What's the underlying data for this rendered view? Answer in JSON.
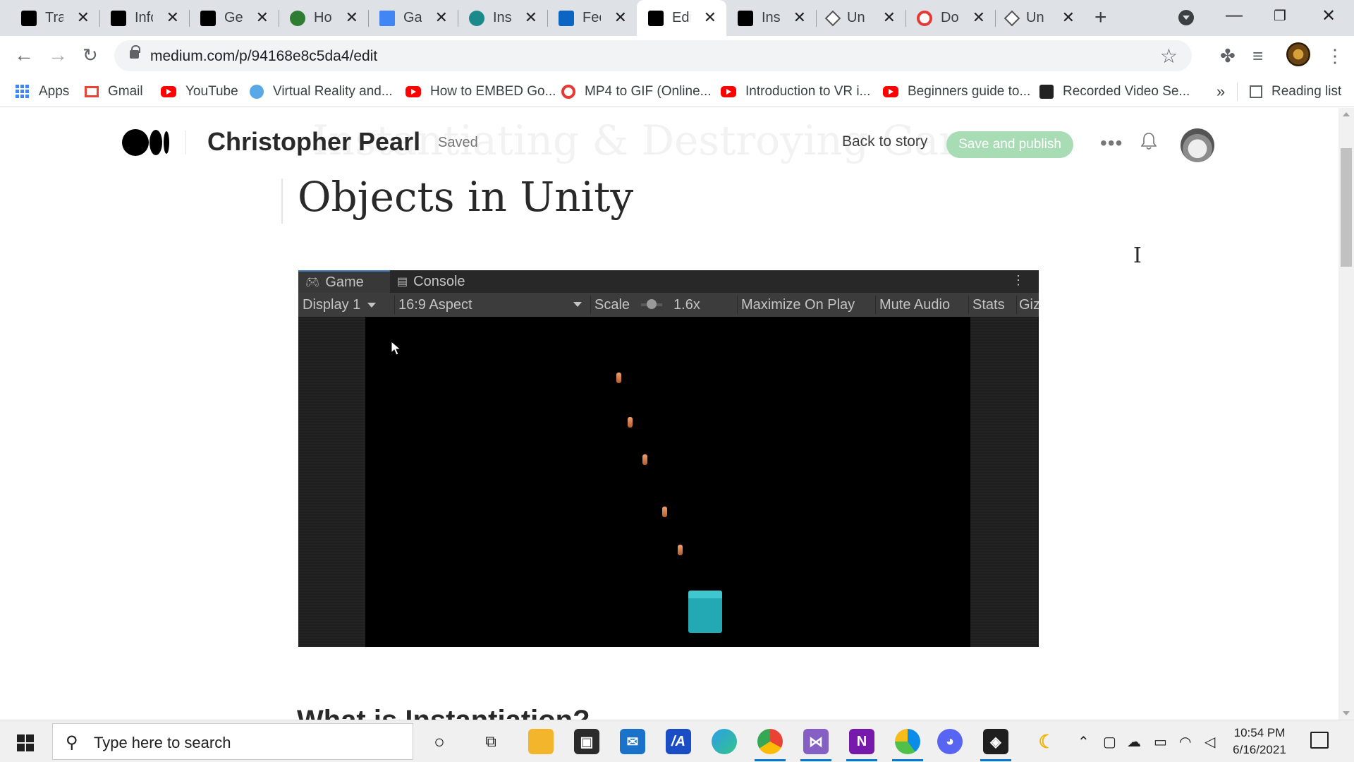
{
  "browser": {
    "tabs": [
      {
        "title": "Tran",
        "icon": "medium-icon",
        "active": false
      },
      {
        "title": "Info",
        "icon": "oculus-icon",
        "active": false
      },
      {
        "title": "Gen",
        "icon": "oculus-icon",
        "active": false
      },
      {
        "title": "How",
        "icon": "vr-icon",
        "active": false
      },
      {
        "title": "Gan",
        "icon": "google-docs-icon",
        "active": false
      },
      {
        "title": "Inst",
        "icon": "globe-icon",
        "active": false
      },
      {
        "title": "Fee",
        "icon": "linkedin-icon",
        "active": false
      },
      {
        "title": "Edit",
        "icon": "medium-icon",
        "active": true
      },
      {
        "title": "Inst",
        "icon": "medium-icon",
        "active": false
      },
      {
        "title": "Unit",
        "icon": "unity-icon",
        "active": false
      },
      {
        "title": "Dov",
        "icon": "mp4-gif-icon",
        "active": false
      },
      {
        "title": "Unit",
        "icon": "unity-icon",
        "active": false
      }
    ],
    "new_tab": "+",
    "url": "medium.com/p/94168e8c5da4/edit",
    "bookmarks": [
      {
        "label": "Apps",
        "icon": "apps-grid-icon"
      },
      {
        "label": "Gmail",
        "icon": "gmail-icon"
      },
      {
        "label": "YouTube",
        "icon": "youtube-icon"
      },
      {
        "label": "Virtual Reality and...",
        "icon": "vr-icon"
      },
      {
        "label": "How to EMBED Go...",
        "icon": "youtube-icon"
      },
      {
        "label": "MP4 to GIF (Online...",
        "icon": "mp4-gif-icon"
      },
      {
        "label": "Introduction to VR i...",
        "icon": "youtube-icon"
      },
      {
        "label": "Beginners guide to...",
        "icon": "youtube-icon"
      },
      {
        "label": "Recorded Video Se...",
        "icon": "unity-icon"
      }
    ],
    "bookmarks_overflow": "»",
    "reading_list": "Reading list"
  },
  "editor": {
    "author": "Christopher Pearl",
    "status": "Saved",
    "ghost_title": "Instantiating & Destroying Game",
    "back_link": "Back to story",
    "publish_label": "Save and publish",
    "more": "•••",
    "post_title": "Objects in Unity",
    "next_heading": "What is Instantiation?"
  },
  "unity_game": {
    "tab_game": "Game",
    "tab_console": "Console",
    "display": "Display 1",
    "aspect": "16:9 Aspect",
    "scale_label": "Scale",
    "scale_value": "1.6x",
    "maximize": "Maximize On Play",
    "mute": "Mute Audio",
    "stats": "Stats",
    "gizmos": "Giz",
    "player_color": "#23a9b4",
    "laser_color": "#d07a45"
  },
  "taskbar": {
    "search_placeholder": "Type here to search",
    "time": "10:54 PM",
    "date": "6/16/2021"
  }
}
